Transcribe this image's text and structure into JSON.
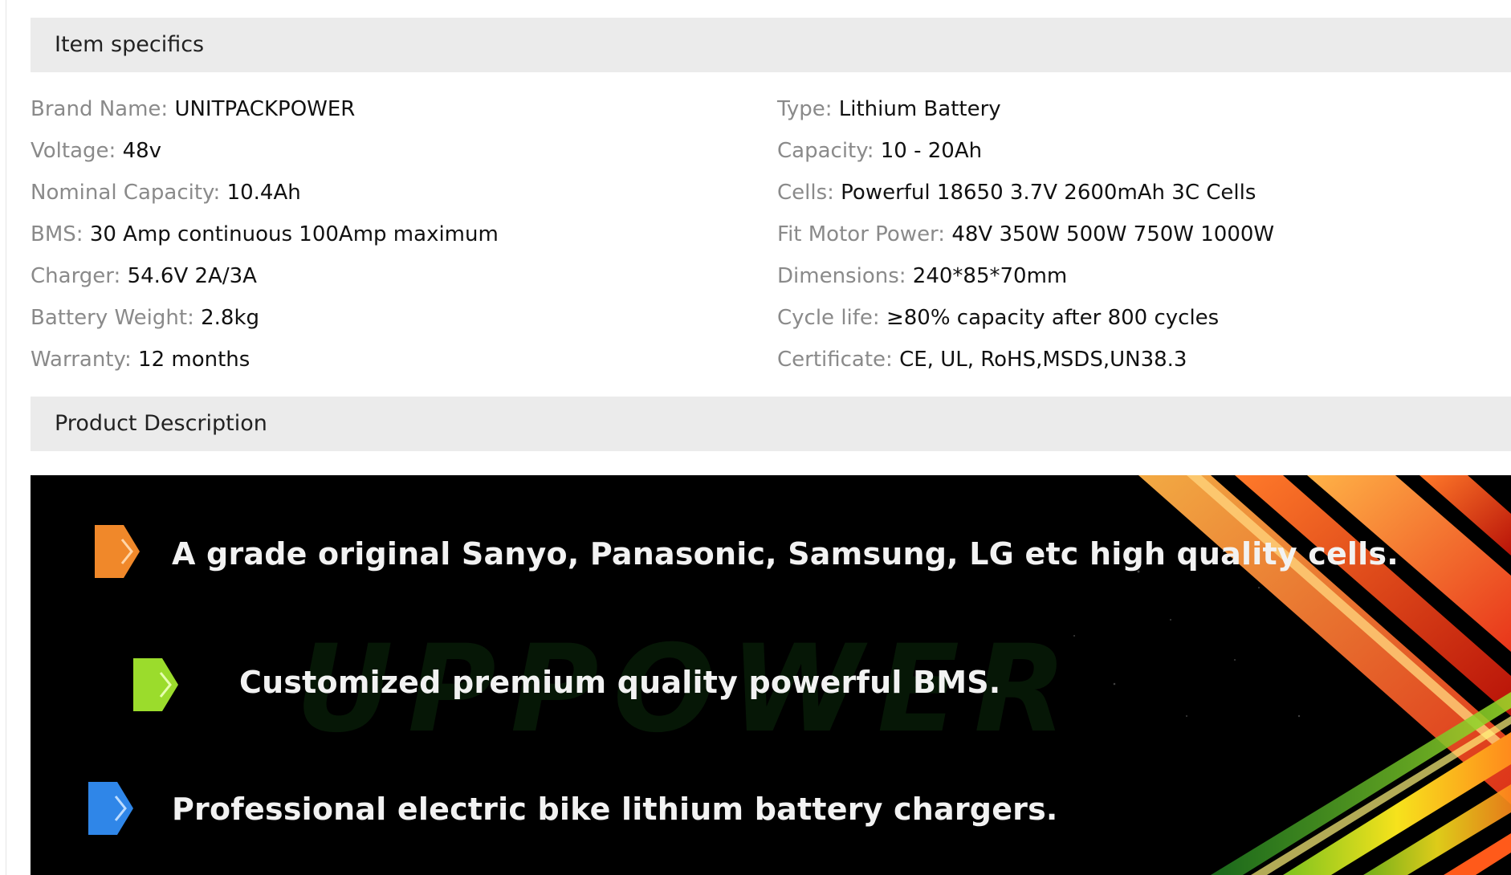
{
  "item_specifics": {
    "title": "Item specifics",
    "left": [
      {
        "key": "Brand Name:",
        "value": "UNITPACKPOWER"
      },
      {
        "key": "Voltage:",
        "value": "48v"
      },
      {
        "key": "Nominal Capacity:",
        "value": "10.4Ah"
      },
      {
        "key": "BMS:",
        "value": "30 Amp continuous 100Amp maximum"
      },
      {
        "key": "Charger:",
        "value": "54.6V 2A/3A"
      },
      {
        "key": "Battery Weight:",
        "value": "2.8kg"
      },
      {
        "key": "Warranty:",
        "value": "12 months"
      }
    ],
    "right": [
      {
        "key": "Type:",
        "value": "Lithium Battery"
      },
      {
        "key": "Capacity:",
        "value": "10 - 20Ah"
      },
      {
        "key": "Cells:",
        "value": "Powerful 18650 3.7V 2600mAh 3C Cells"
      },
      {
        "key": "Fit Motor Power:",
        "value": "48V 350W 500W 750W 1000W"
      },
      {
        "key": "Dimensions:",
        "value": "240*85*70mm"
      },
      {
        "key": "Cycle life:",
        "value": "≥80% capacity after 800 cycles"
      },
      {
        "key": "Certificate:",
        "value": "CE, UL, RoHS,MSDS,UN38.3"
      }
    ]
  },
  "product_description": {
    "title": "Product Description",
    "banner": {
      "watermark": "UPPOWER",
      "features": [
        {
          "text": "A grade original Sanyo, Panasonic, Samsung, LG etc high quality cells.",
          "color": "#f0882a"
        },
        {
          "text": "Customized premium quality powerful BMS.",
          "color": "#9bdc2c"
        },
        {
          "text": "Professional electric bike lithium battery chargers.",
          "color": "#2f86e8"
        }
      ]
    }
  }
}
